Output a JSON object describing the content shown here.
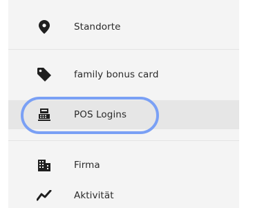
{
  "menu": {
    "items": [
      {
        "id": "standorte",
        "label": "Standorte",
        "icon": "location-pin-icon",
        "active": false
      },
      {
        "id": "family-bonus-card",
        "label": "family bonus card",
        "icon": "tag-icon",
        "active": false
      },
      {
        "id": "pos-logins",
        "label": "POS Logins",
        "icon": "cash-register-icon",
        "active": true
      },
      {
        "id": "firma",
        "label": "Firma",
        "icon": "building-icon",
        "active": false
      },
      {
        "id": "aktivitaet",
        "label": "Aktivität",
        "icon": "activity-chart-icon",
        "active": false
      }
    ]
  },
  "highlight": {
    "target": "pos-logins",
    "color": "#7aa0f5"
  },
  "colors": {
    "panel_background": "#f4f4f4",
    "active_background": "#e6e6e6",
    "icon_color": "#1f1f1f",
    "text_color": "#2a2a2a"
  }
}
